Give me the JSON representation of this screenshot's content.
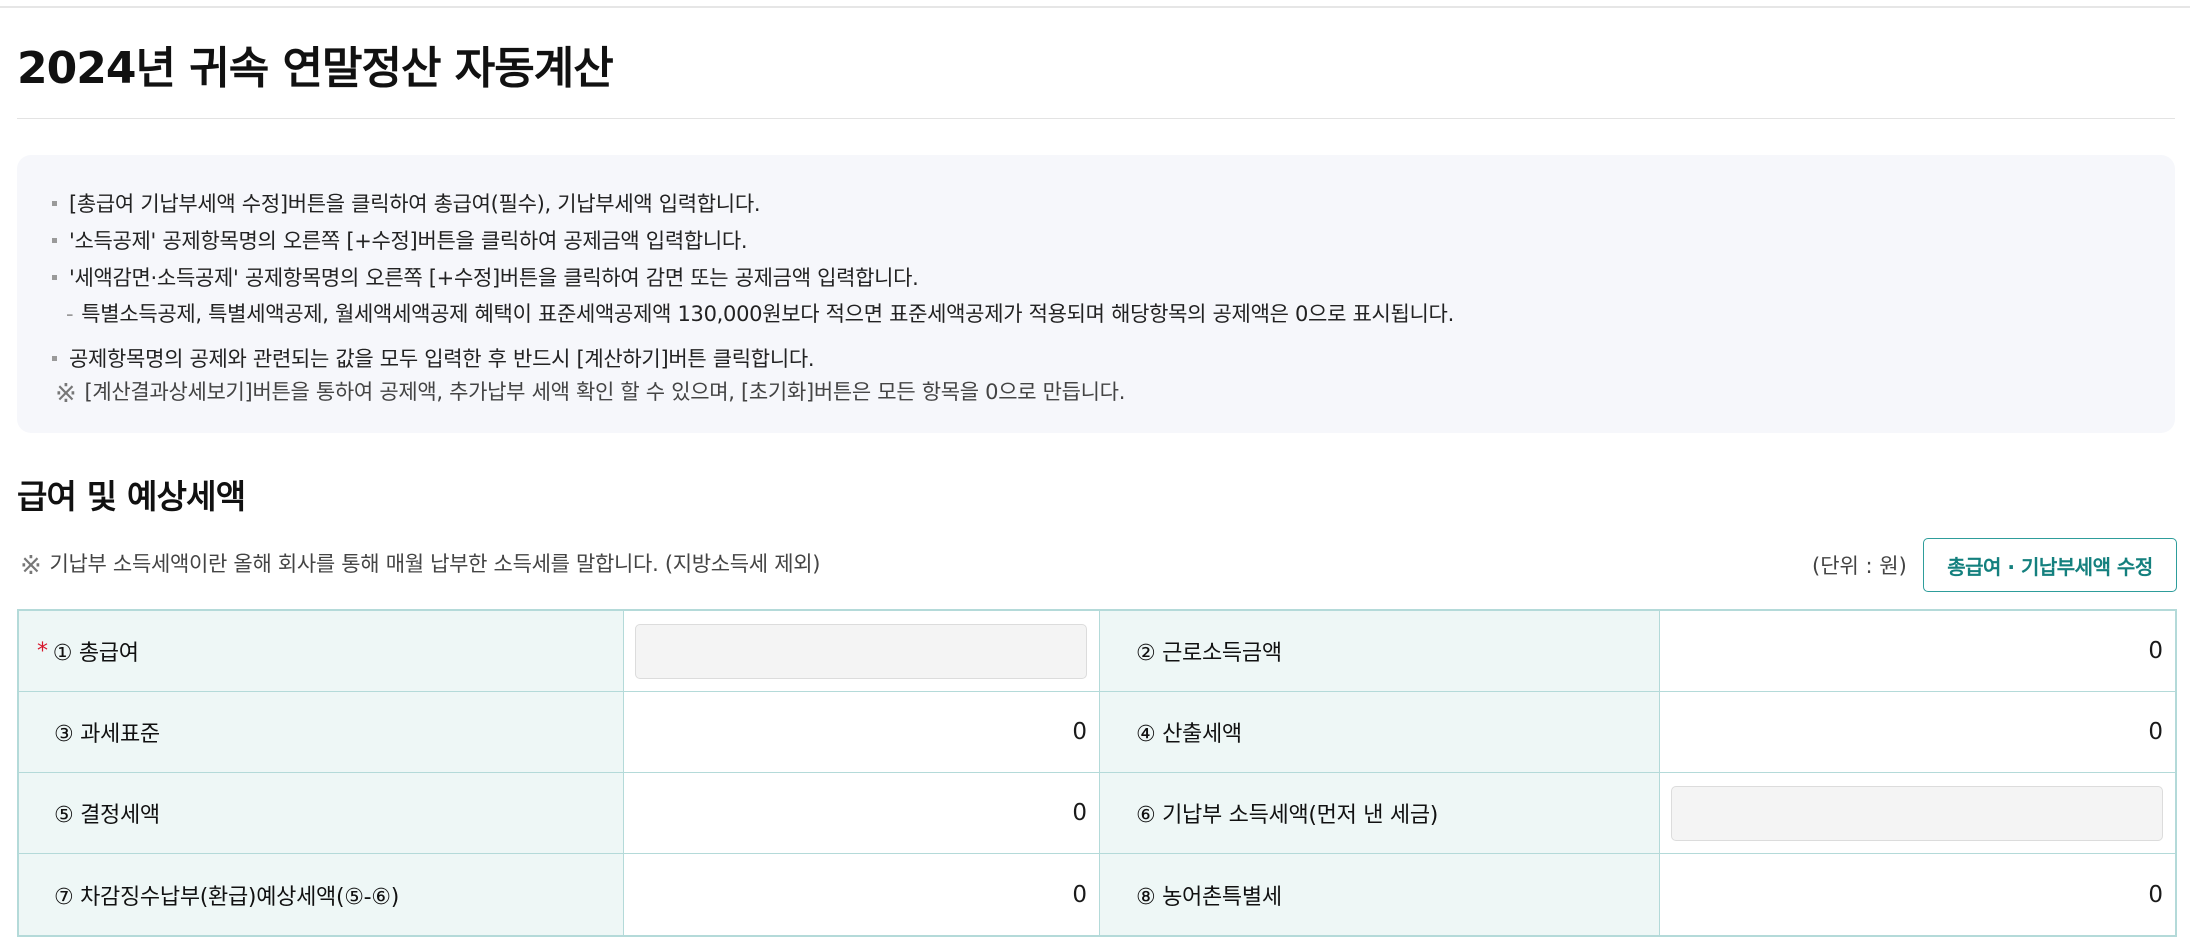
{
  "page": {
    "title": "2024년 귀속 연말정산 자동계산"
  },
  "notice": {
    "lines": [
      "[총급여 기납부세액 수정]버튼을 클릭하여 총급여(필수), 기납부세액 입력합니다.",
      "'소득공제' 공제항목명의 오른쪽 [+수정]버튼을 클릭하여 공제금액 입력합니다.",
      "'세액감면·소득공제' 공제항목명의 오른쪽 [+수정]버튼을 클릭하여 감면 또는 공제금액 입력합니다.",
      "특별소득공제, 특별세액공제, 월세액세액공제 혜택이 표준세액공제액 130,000원보다 적으면 표준세액공제가 적용되며 해당항목의 공제액은 0으로 표시됩니다.",
      "공제항목명의 공제와 관련되는 값을 모두 입력한 후 반드시 [계산하기]버튼 클릭합니다."
    ],
    "ref_mark": "※",
    "ref_note": "[계산결과상세보기]버튼을 통하여 공제액, 추가납부 세액 확인 할 수 있으며, [초기화]버튼은 모든 항목을 0으로 만듭니다."
  },
  "section": {
    "title": "급여 및 예상세액",
    "note": "기납부 소득세액이란 올해 회사를 통해 매월 납부한 소득세를 말합니다. (지방소득세 제외)",
    "unit": "(단위 : 원)",
    "edit_button": "총급여 · 기납부세액 수정"
  },
  "grid": {
    "required_mark": "*",
    "rows": [
      {
        "left_label": "① 총급여",
        "left_value": "",
        "right_label": "② 근로소득금액",
        "right_value": "0"
      },
      {
        "left_label": "③ 과세표준",
        "left_value": "0",
        "right_label": "④ 산출세액",
        "right_value": "0"
      },
      {
        "left_label": "⑤ 결정세액",
        "left_value": "0",
        "right_label": "⑥ 기납부 소득세액(먼저 낸 세금)",
        "right_value": ""
      },
      {
        "left_label": "⑦ 차감징수납부(환급)예상세액(⑤-⑥)",
        "left_value": "0",
        "right_label": "⑧ 농어촌특별세",
        "right_value": "0"
      }
    ]
  }
}
